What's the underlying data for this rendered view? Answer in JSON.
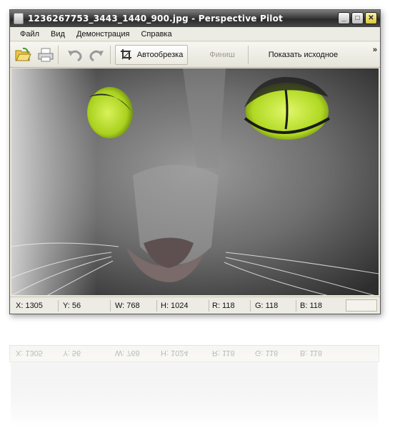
{
  "window": {
    "title": "1236267753_3443_1440_900.jpg - Perspective Pilot",
    "controls": {
      "minimize": "_",
      "maximize": "□",
      "close": "✕"
    }
  },
  "menu": {
    "items": [
      {
        "label": "Файл"
      },
      {
        "label": "Вид"
      },
      {
        "label": "Демонстрация"
      },
      {
        "label": "Справка"
      }
    ]
  },
  "toolbar": {
    "icons": [
      "open-folder-icon",
      "print-icon",
      "undo-icon",
      "redo-icon",
      "crop-icon"
    ],
    "auto_crop_label": "Автообрезка",
    "finish_label": "Финиш",
    "show_original_label": "Показать исходное",
    "overflow": "»"
  },
  "image": {
    "eye_color": "#b6e62b",
    "fur_color": "#6b6b6b"
  },
  "status": {
    "x": "X: 1305",
    "y": "Y: 56",
    "w": "W: 768",
    "h": "H: 1024",
    "r": "R: 118",
    "g": "G: 118",
    "b": "B: 118"
  },
  "reflection": {
    "x": "X: 1305",
    "y": "Y: 56",
    "w": "W: 768",
    "h": "H: 1024",
    "r": "R: 118",
    "g": "G: 118",
    "b": "B: 118"
  }
}
